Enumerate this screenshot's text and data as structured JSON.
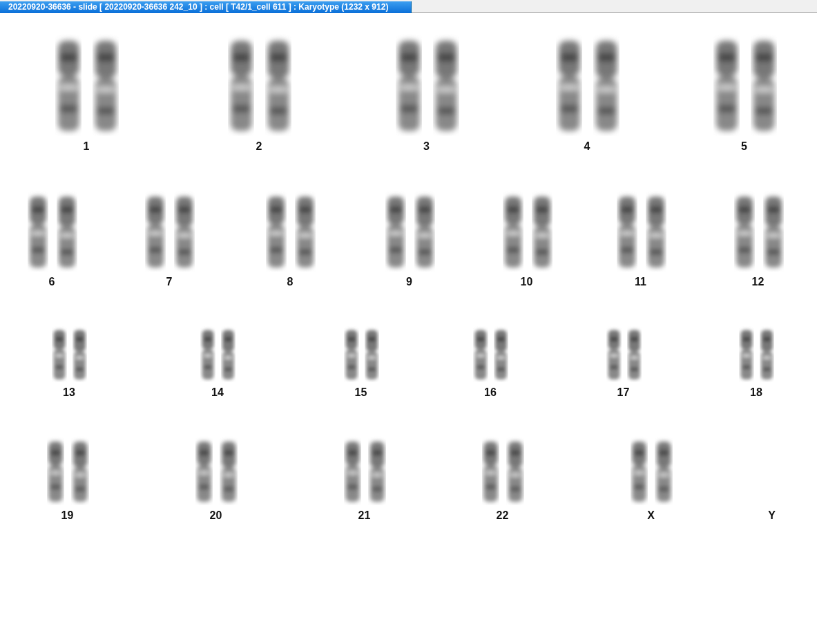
{
  "window": {
    "title": "20220920-36636 - slide [ 20220920-36636 242_10 ] : cell [ T42/1_cell 611 ] : Karyotype  (1232 x 912)"
  },
  "karyotype": {
    "rows": [
      {
        "pairs": [
          {
            "label": "1",
            "kind": "pair"
          },
          {
            "label": "2",
            "kind": "pair"
          },
          {
            "label": "3",
            "kind": "pair"
          },
          {
            "label": "4",
            "kind": "pair"
          },
          {
            "label": "5",
            "kind": "pair"
          }
        ]
      },
      {
        "pairs": [
          {
            "label": "6",
            "kind": "pair"
          },
          {
            "label": "7",
            "kind": "pair"
          },
          {
            "label": "8",
            "kind": "pair"
          },
          {
            "label": "9",
            "kind": "pair"
          },
          {
            "label": "10",
            "kind": "pair"
          },
          {
            "label": "11",
            "kind": "pair"
          },
          {
            "label": "12",
            "kind": "pair"
          }
        ]
      },
      {
        "pairs": [
          {
            "label": "13",
            "kind": "pair"
          },
          {
            "label": "14",
            "kind": "pair"
          },
          {
            "label": "15",
            "kind": "pair"
          },
          {
            "label": "16",
            "kind": "pair"
          },
          {
            "label": "17",
            "kind": "pair"
          },
          {
            "label": "18",
            "kind": "pair"
          }
        ]
      },
      {
        "pairs": [
          {
            "label": "19",
            "kind": "pair"
          },
          {
            "label": "20",
            "kind": "pair"
          },
          {
            "label": "21",
            "kind": "pair"
          },
          {
            "label": "22",
            "kind": "pair"
          },
          {
            "label": "X",
            "kind": "pair"
          },
          {
            "label": "Y",
            "kind": "empty"
          }
        ]
      }
    ]
  }
}
